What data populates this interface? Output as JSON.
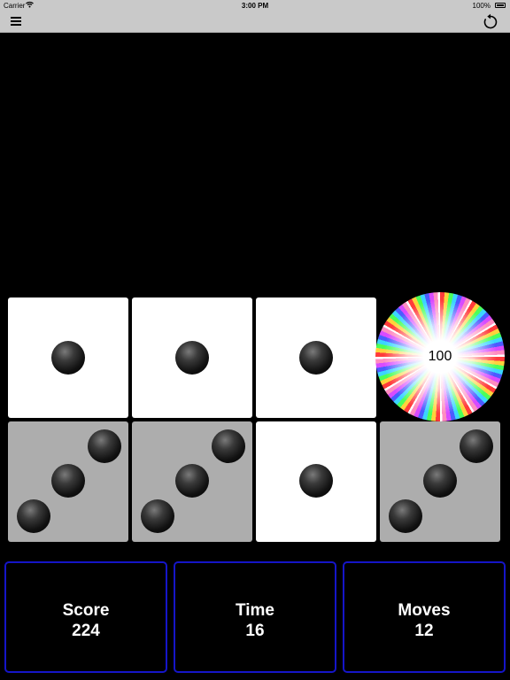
{
  "status_bar": {
    "carrier": "Carrier",
    "time": "3:00 PM",
    "battery": "100%"
  },
  "toolbar": {
    "menu_icon": "hamburger-menu-icon",
    "restart_icon": "restart-arrow-icon"
  },
  "board": {
    "top_row": [
      {
        "value": 1,
        "state": "selected"
      },
      {
        "value": 1,
        "state": "selected"
      },
      {
        "value": 1,
        "state": "selected"
      },
      {
        "value": null,
        "state": "burst",
        "label": "100"
      }
    ],
    "bottom_row": [
      {
        "value": 3,
        "state": "unselected"
      },
      {
        "value": 3,
        "state": "unselected"
      },
      {
        "value": 1,
        "state": "selected"
      },
      {
        "value": 3,
        "state": "unselected"
      }
    ],
    "colors": {
      "selected_face": "#ffffff",
      "unselected_face": "#adadad",
      "pip": "#111111",
      "stat_border": "#1515c8"
    }
  },
  "stats": {
    "score_label": "Score",
    "score_value": "224",
    "time_label": "Time",
    "time_value": "16",
    "moves_label": "Moves",
    "moves_value": "12"
  }
}
